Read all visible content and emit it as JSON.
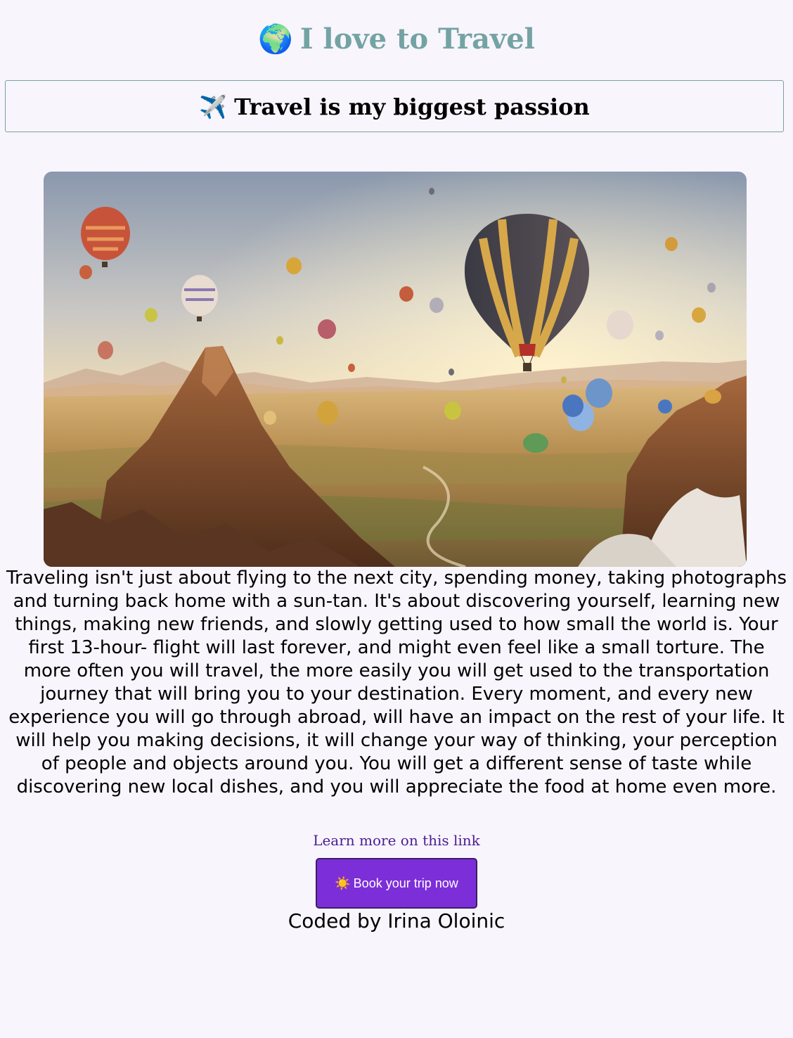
{
  "header": {
    "title_emoji": "🌍",
    "title": "I love to Travel"
  },
  "subtitle": {
    "emoji": "✈️",
    "text": "Travel is my biggest passion"
  },
  "hero": {
    "alt": "Hot air balloons over a rocky valley at sunrise"
  },
  "main": {
    "description": "Traveling isn't just about flying to the next city, spending money, taking photographs and turning back home with a sun-tan. It's about discovering yourself, learning new things, making new friends, and slowly getting used to how small the world is. Your first 13-hour- flight will last forever, and might even feel like a small torture. The more often you will travel, the more easily you will get used to the transportation journey that will bring you to your destination. Every moment, and every new experience you will go through abroad, will have an impact on the rest of your life. It will help you making decisions, it will change your way of thinking, your perception of people and objects around you. You will get a different sense of taste while discovering new local dishes, and you will appreciate the food at home even more.",
    "link_label": "Learn more on this link"
  },
  "cta": {
    "icon": "☀️",
    "label": "Book your trip now",
    "background": "#7c2fd8"
  },
  "footer": {
    "credit": "Coded by Irina Oloinic"
  },
  "colors": {
    "title": "#74a3a3",
    "link": "#4c1c91",
    "page_background": "#f8f5fd"
  }
}
